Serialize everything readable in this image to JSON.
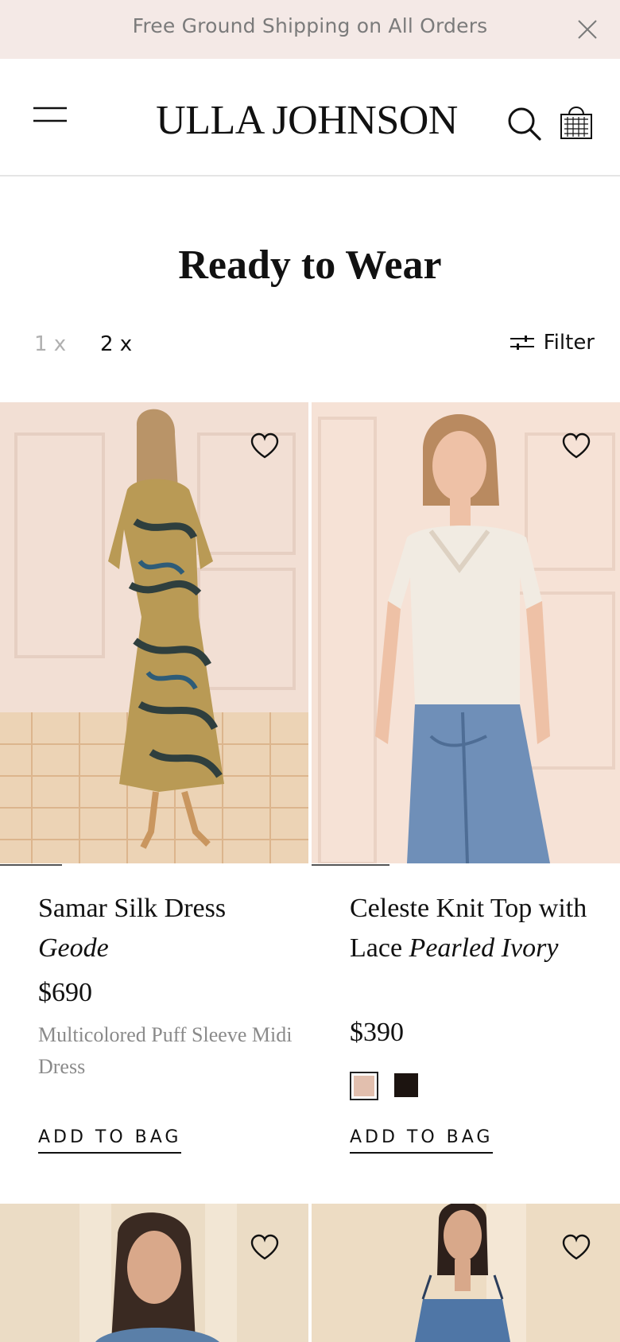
{
  "promo": {
    "text": "Free Ground Shipping on All Orders",
    "close_icon": "close-icon"
  },
  "header": {
    "logo": "ULLA JOHNSON",
    "menu_icon": "hamburger-icon",
    "search_icon": "search-icon",
    "bag_icon": "shopping-bag-icon"
  },
  "page": {
    "title": "Ready to Wear"
  },
  "view_toggle": {
    "one_x": "1 x",
    "two_x": "2 x",
    "active": "2 x"
  },
  "filter": {
    "label": "Filter",
    "icon": "sliders-icon"
  },
  "products": [
    {
      "name": "Samar Silk Dress",
      "color": "Geode",
      "price": "$690",
      "description": "Multicolored Puff Sleeve Midi Dress",
      "add_label": "ADD TO BAG",
      "wishlist_icon": "heart-icon"
    },
    {
      "name": "Celeste Knit Top with Lace",
      "color": "Pearled Ivory",
      "price": "$390",
      "swatches": [
        "#e2bfae",
        "#1c1410"
      ],
      "add_label": "ADD TO BAG",
      "wishlist_icon": "heart-icon"
    },
    {
      "wishlist_icon": "heart-icon"
    },
    {
      "wishlist_icon": "heart-icon"
    }
  ],
  "colors": {
    "promo_bg": "#f4e9e6",
    "muted_text": "#8a8a8a",
    "text": "#111111"
  }
}
